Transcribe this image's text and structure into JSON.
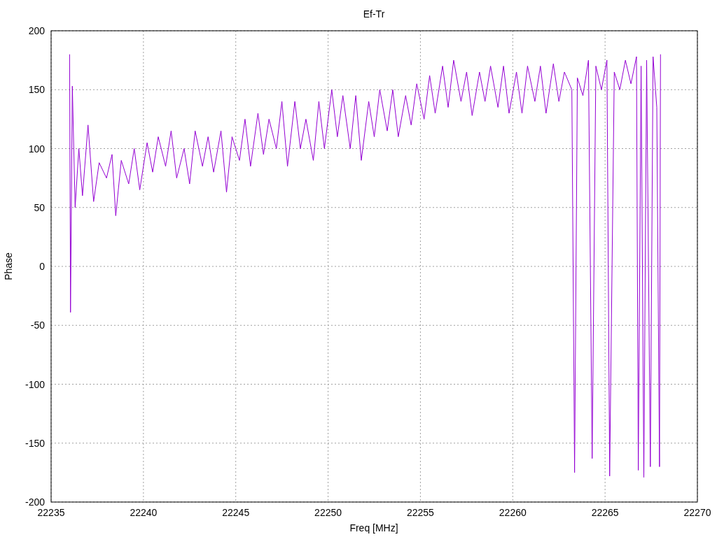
{
  "chart_data": {
    "type": "line",
    "title": "Ef-Tr",
    "xlabel": "Freq [MHz]",
    "ylabel": "Phase",
    "xlim": [
      22235,
      22270
    ],
    "ylim": [
      -200,
      200
    ],
    "xticks": [
      22235,
      22240,
      22245,
      22250,
      22255,
      22260,
      22265,
      22270
    ],
    "yticks": [
      -200,
      -150,
      -100,
      -50,
      0,
      50,
      100,
      150,
      200
    ],
    "x": [
      22236.0,
      22236.05,
      22236.15,
      22236.3,
      22236.5,
      22236.7,
      22237.0,
      22237.3,
      22237.6,
      22238.0,
      22238.3,
      22238.5,
      22238.8,
      22239.2,
      22239.5,
      22239.8,
      22240.2,
      22240.5,
      22240.8,
      22241.2,
      22241.5,
      22241.8,
      22242.2,
      22242.5,
      22242.8,
      22243.2,
      22243.5,
      22243.8,
      22244.2,
      22244.5,
      22244.8,
      22245.2,
      22245.5,
      22245.8,
      22246.2,
      22246.5,
      22246.8,
      22247.2,
      22247.5,
      22247.8,
      22248.2,
      22248.5,
      22248.8,
      22249.2,
      22249.5,
      22249.8,
      22250.2,
      22250.5,
      22250.8,
      22251.2,
      22251.5,
      22251.8,
      22252.2,
      22252.5,
      22252.8,
      22253.2,
      22253.5,
      22253.8,
      22254.2,
      22254.5,
      22254.8,
      22255.2,
      22255.5,
      22255.8,
      22256.2,
      22256.5,
      22256.8,
      22257.2,
      22257.5,
      22257.8,
      22258.2,
      22258.5,
      22258.8,
      22259.2,
      22259.5,
      22259.8,
      22260.2,
      22260.5,
      22260.8,
      22261.2,
      22261.5,
      22261.8,
      22262.2,
      22262.5,
      22262.8,
      22263.2,
      22263.35,
      22263.5,
      22263.8,
      22264.1,
      22264.3,
      22264.5,
      22264.8,
      22265.1,
      22265.25,
      22265.5,
      22265.8,
      22266.1,
      22266.4,
      22266.7,
      22266.8,
      22266.95,
      22267.1,
      22267.25,
      22267.45,
      22267.6,
      22267.8,
      22267.95,
      22268.0
    ],
    "grid": true,
    "series": [
      {
        "color": "#9400d3",
        "values": [
          180,
          -39,
          153,
          50,
          100,
          60,
          120,
          55,
          88,
          75,
          95,
          43,
          90,
          70,
          100,
          65,
          105,
          80,
          110,
          85,
          115,
          75,
          100,
          70,
          115,
          85,
          110,
          80,
          115,
          63,
          110,
          90,
          125,
          85,
          130,
          95,
          125,
          100,
          140,
          85,
          140,
          100,
          125,
          90,
          140,
          100,
          150,
          110,
          145,
          100,
          145,
          90,
          140,
          110,
          150,
          115,
          150,
          110,
          145,
          120,
          155,
          125,
          162,
          130,
          170,
          135,
          175,
          140,
          165,
          128,
          165,
          140,
          170,
          135,
          170,
          130,
          165,
          130,
          170,
          140,
          170,
          130,
          172,
          140,
          165,
          150,
          -175,
          160,
          145,
          175,
          -163,
          170,
          150,
          175,
          -178,
          165,
          150,
          175,
          155,
          178,
          -173,
          170,
          -179,
          175,
          -170,
          178,
          135,
          -170,
          180
        ]
      }
    ]
  }
}
